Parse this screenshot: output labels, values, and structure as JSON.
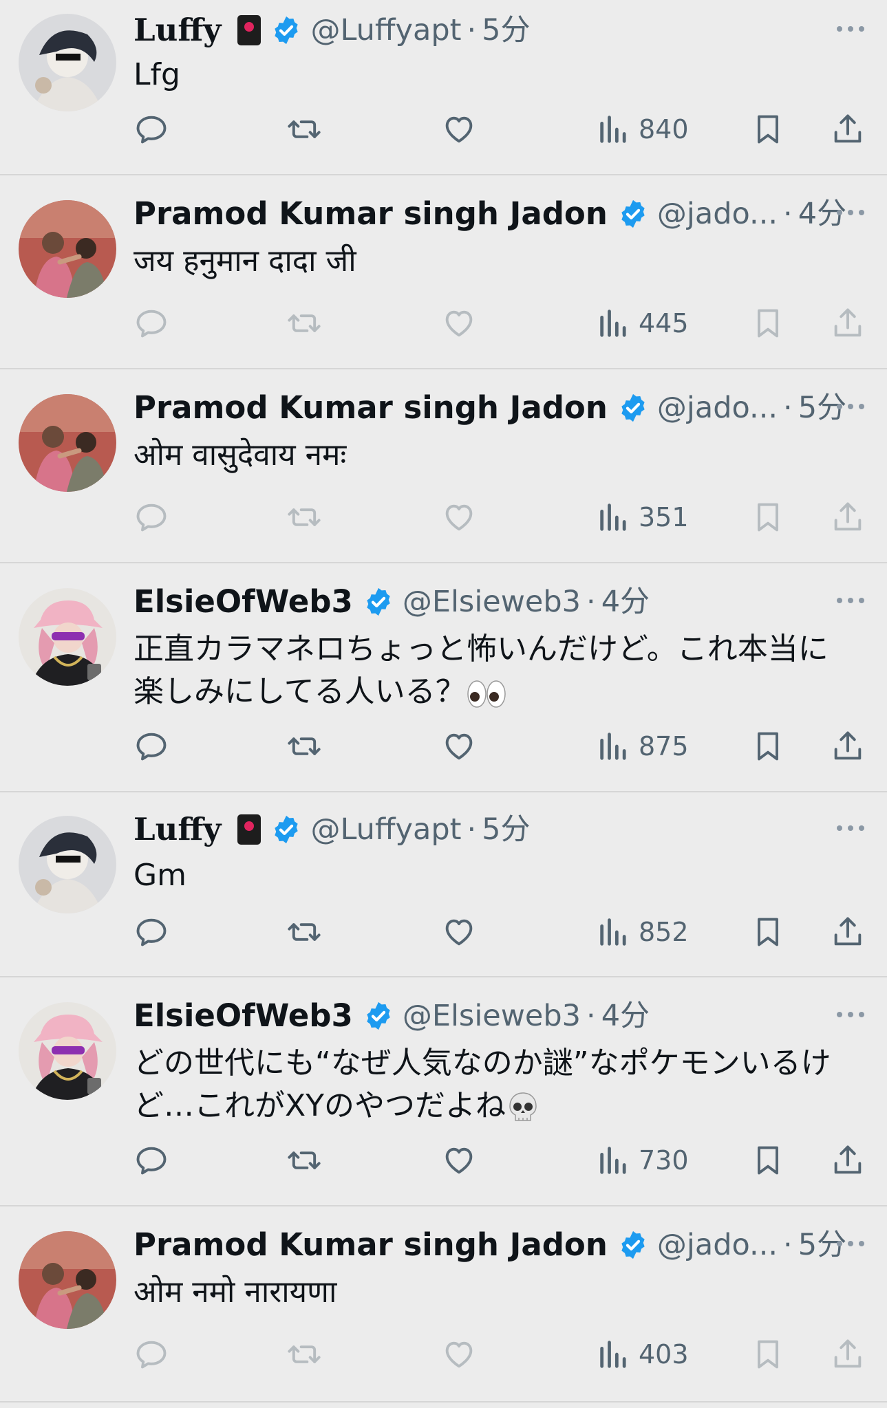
{
  "tweets": [
    {
      "name": "Luffy",
      "handle": "@Luffyapt",
      "sep": "·",
      "time": "5分",
      "text": "Lfg",
      "views": "840",
      "active": true,
      "avatar": "luffy"
    },
    {
      "name": "Pramod Kumar singh Jadon",
      "handle": "@jado...",
      "sep": "·",
      "time": "4分",
      "text": "जय हनुमान दादा जी",
      "views": "445",
      "active": false,
      "avatar": "pramod"
    },
    {
      "name": "Pramod Kumar singh Jadon",
      "handle": "@jado...",
      "sep": "·",
      "time": "5分",
      "text": "ओम वासुदेवाय नमः",
      "views": "351",
      "active": false,
      "avatar": "pramod"
    },
    {
      "name": "ElsieOfWeb3",
      "handle": "@Elsieweb3",
      "sep": "·",
      "time": "4分",
      "text": "正直カラマネロちょっと怖いんだけど。これ本当に\n楽しみにしてる人いる？",
      "views": "875",
      "active": true,
      "avatar": "elsie",
      "emoji": "eyes-emoji"
    },
    {
      "name": "Luffy",
      "handle": "@Luffyapt",
      "sep": "·",
      "time": "5分",
      "text": "Gm",
      "views": "852",
      "active": true,
      "avatar": "luffy"
    },
    {
      "name": "ElsieOfWeb3",
      "handle": "@Elsieweb3",
      "sep": "·",
      "time": "4分",
      "text": "どの世代にも“なぜ人気なのか謎”なポケモンいるけ\nど…これがXYのやつだよね",
      "views": "730",
      "active": true,
      "avatar": "elsie",
      "emoji": "skull-emoji"
    },
    {
      "name": "Pramod Kumar singh Jadon",
      "handle": "@jado...",
      "sep": "·",
      "time": "5分",
      "text": "ओम नमो नारायणा",
      "views": "403",
      "active": false,
      "avatar": "pramod"
    }
  ],
  "colors": {
    "background": "#ececec",
    "text": "#0f1419",
    "muted": "#536471",
    "verified": "#1d9bf0",
    "divider": "#d6d6d6"
  },
  "icons": {
    "reply": "reply-icon",
    "retweet": "retweet-icon",
    "like": "like-icon",
    "views": "views-icon",
    "bookmark": "bookmark-icon",
    "share": "share-icon",
    "more": "more-icon",
    "verified": "verified-badge-icon"
  }
}
